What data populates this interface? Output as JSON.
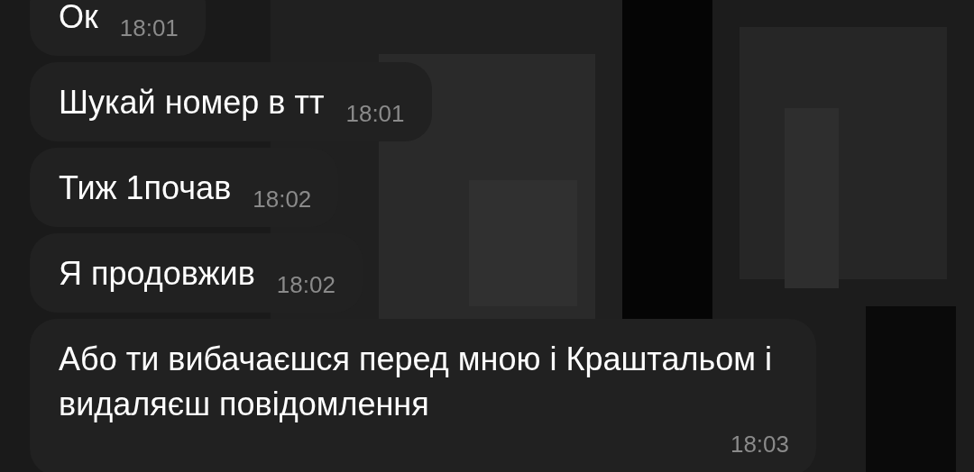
{
  "messages": [
    {
      "kind": "inline",
      "text": "Ок",
      "time": "18:01"
    },
    {
      "kind": "inline",
      "text": "Шукай номер в тт",
      "time": "18:01"
    },
    {
      "kind": "inline",
      "text": "Тиж 1почав",
      "time": "18:02"
    },
    {
      "kind": "inline",
      "text": "Я продовжив",
      "time": "18:02"
    },
    {
      "kind": "block",
      "text": "Або ти вибачаєшся перед мною і Краштальом і видаляєш повідомлення",
      "time": "18:03"
    }
  ]
}
